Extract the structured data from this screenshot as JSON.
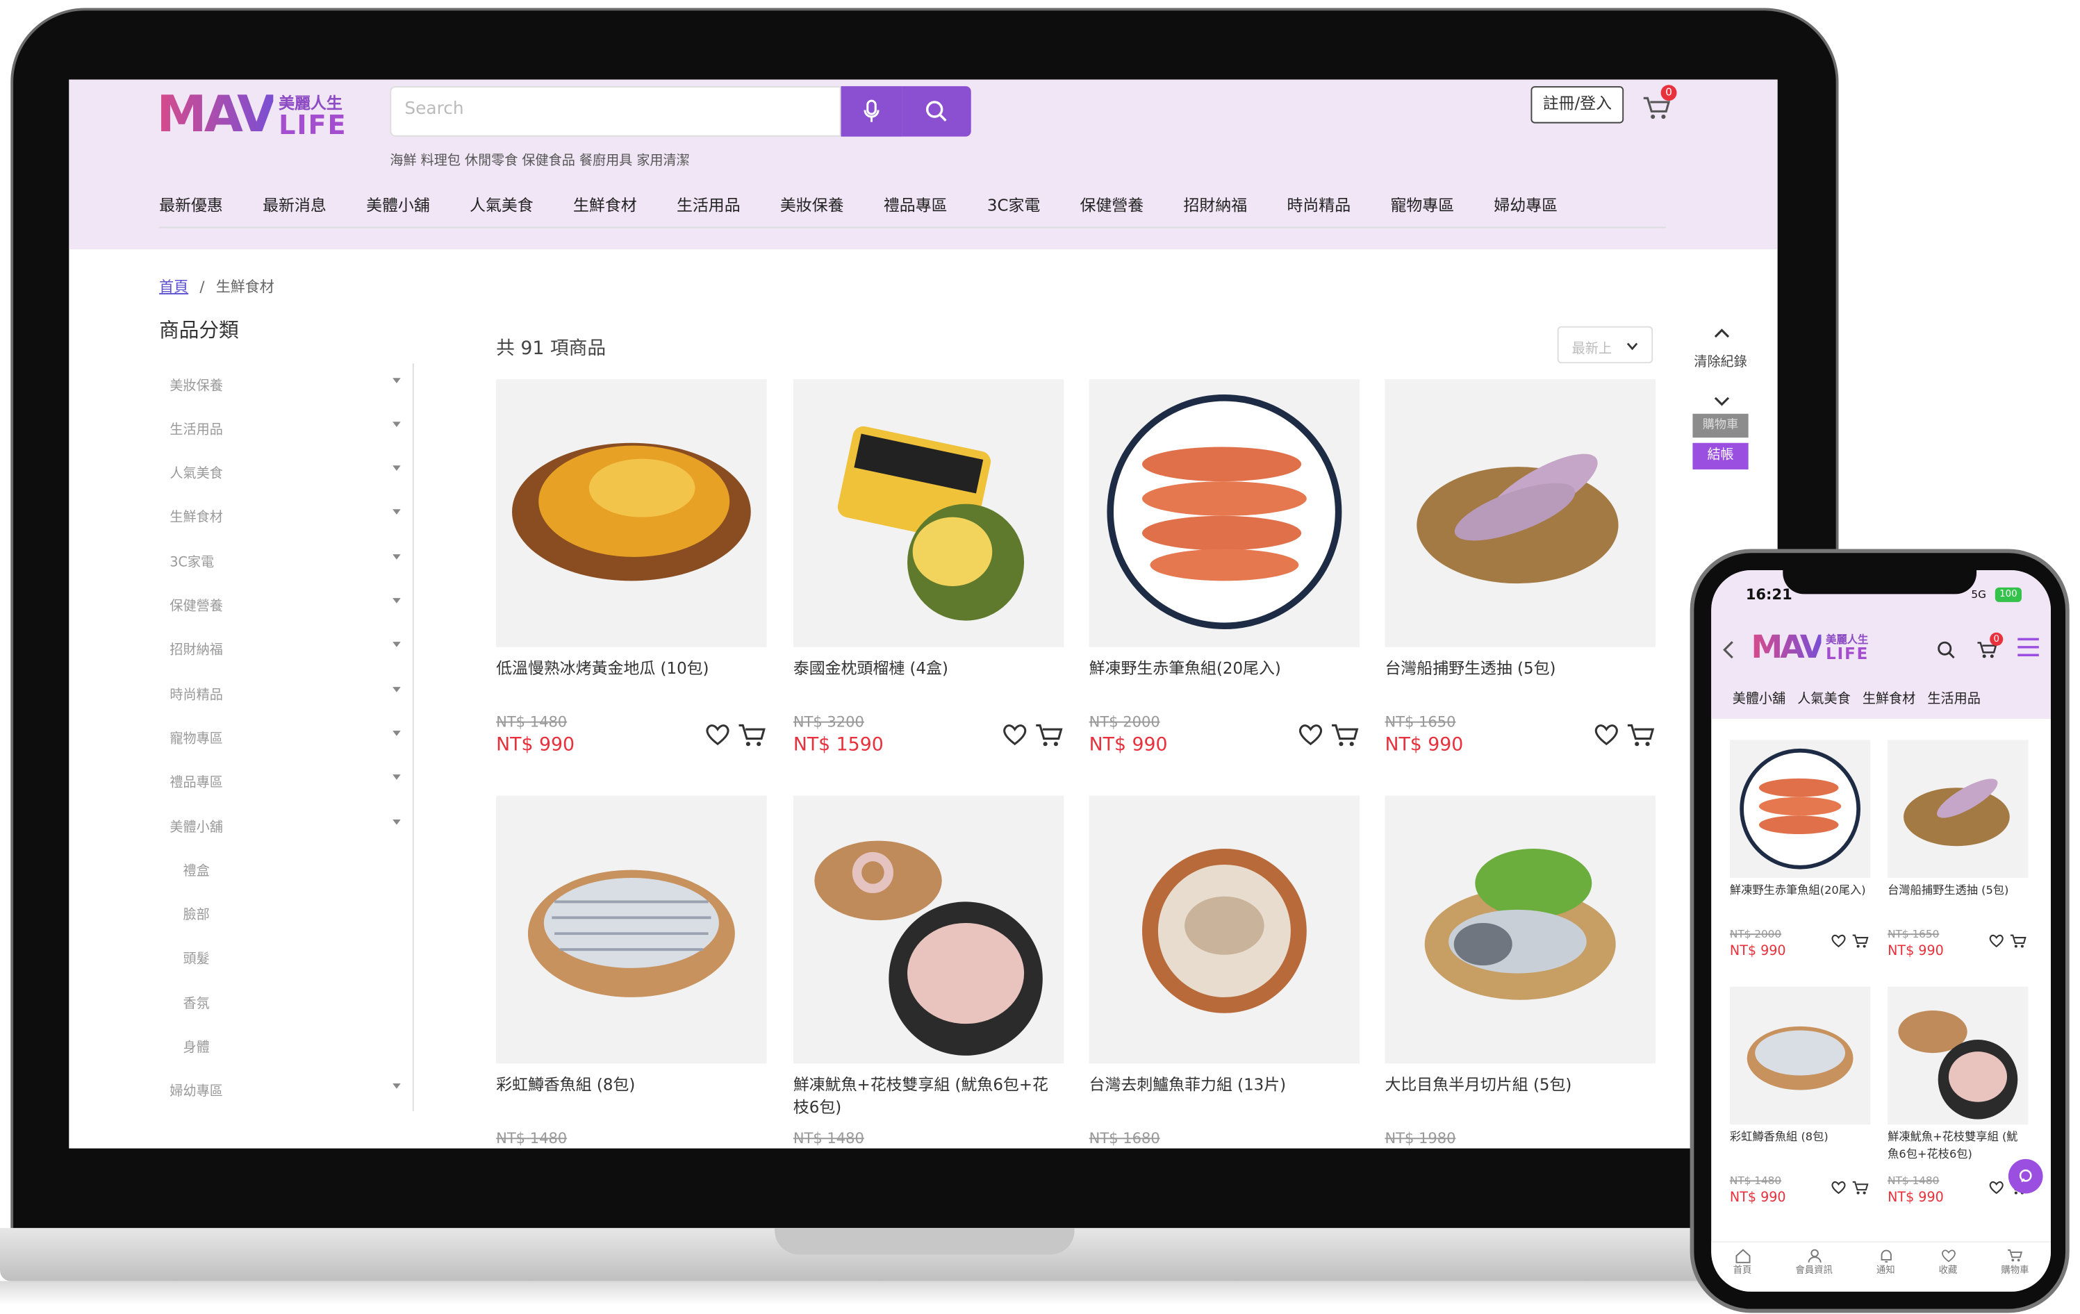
{
  "header": {
    "logo_text": "MAV",
    "logo_cn": "美麗人生",
    "logo_life": "LIFE",
    "search_placeholder": "Search",
    "hot_words": "海鮮 料理包 休閒零食 保健食品 餐廚用具 家用清潔",
    "login_label": "註冊/登入",
    "cart_count": "0"
  },
  "nav": [
    "最新優惠",
    "最新消息",
    "美體小舖",
    "人氣美食",
    "生鮮食材",
    "生活用品",
    "美妝保養",
    "禮品專區",
    "3C家電",
    "保健營養",
    "招財納福",
    "時尚精品",
    "寵物專區",
    "婦幼專區"
  ],
  "breadcrumb": {
    "home": "首頁",
    "sep": "/",
    "current": "生鮮食材"
  },
  "sidebar": {
    "title": "商品分類",
    "items": [
      "美妝保養",
      "生活用品",
      "人氣美食",
      "生鮮食材",
      "3C家電",
      "保健營養",
      "招財納福",
      "時尚精品",
      "寵物專區",
      "禮品專區",
      "美體小舖"
    ],
    "sub_items": [
      "禮盒",
      "臉部",
      "頭髮",
      "香氛",
      "身體"
    ],
    "last_item": "婦幼專區"
  },
  "listing": {
    "count_text": "共 91 項商品",
    "sort_label": "最新上"
  },
  "products": [
    {
      "name": "低溫慢熟冰烤黃金地瓜 (10包)",
      "old": "NT$ 1480",
      "new": "NT$ 990"
    },
    {
      "name": "泰國金枕頭榴槤 (4盒)",
      "old": "NT$ 3200",
      "new": "NT$ 1590"
    },
    {
      "name": "鮮凍野生赤筆魚組(20尾入)",
      "old": "NT$ 2000",
      "new": "NT$ 990"
    },
    {
      "name": "台灣船捕野生透抽 (5包)",
      "old": "NT$ 1650",
      "new": "NT$ 990"
    },
    {
      "name": "彩虹鱒香魚組 (8包)",
      "old": "NT$ 1480",
      "new": ""
    },
    {
      "name": "鮮凍魷魚+花枝雙享組 (魷魚6包+花枝6包)",
      "old": "NT$ 1480",
      "new": ""
    },
    {
      "name": "台灣去刺鱸魚菲力組 (13片)",
      "old": "NT$ 1680",
      "new": ""
    },
    {
      "name": "大比目魚半月切片組 (5包)",
      "old": "NT$ 1980",
      "new": ""
    }
  ],
  "float_panel": {
    "clear": "清除紀錄",
    "cart": "購物車",
    "checkout": "結帳"
  },
  "phone": {
    "time": "16:21",
    "signal": "5G",
    "battery": "100",
    "cart_count": "0",
    "tabs": [
      "美體小舖",
      "人氣美食",
      "生鮮食材",
      "生活用品"
    ],
    "products": [
      {
        "name": "鮮凍野生赤筆魚組(20尾入)",
        "old": "NT$ 2000",
        "new": "NT$ 990"
      },
      {
        "name": "台灣船捕野生透抽 (5包)",
        "old": "NT$ 1650",
        "new": "NT$ 990"
      },
      {
        "name": "彩虹鱒香魚組 (8包)",
        "old": "NT$ 1480",
        "new": "NT$ 990"
      },
      {
        "name": "鮮凍魷魚+花枝雙享組 (魷魚6包+花枝6包)",
        "old": "NT$ 1480",
        "new": "NT$ 990"
      }
    ],
    "bottom_nav": [
      "首頁",
      "會員資訊",
      "通知",
      "收藏",
      "購物車"
    ]
  },
  "colors": {
    "brand_purple": "#8b4fd1",
    "header_bg": "#f1e6f5",
    "price_red": "#e8313c"
  }
}
